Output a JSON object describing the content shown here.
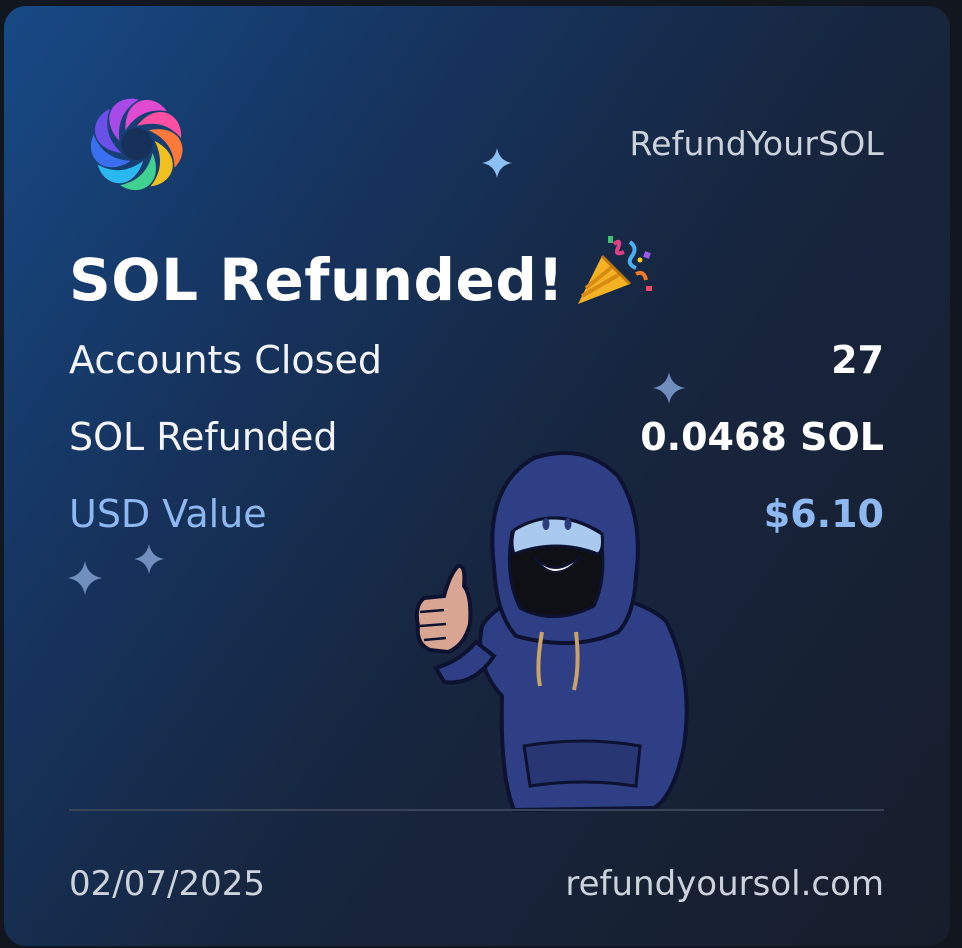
{
  "brand": {
    "name": "RefundYourSOL"
  },
  "title": "SOL Refunded!",
  "stats": [
    {
      "label": "Accounts Closed",
      "value": "27"
    },
    {
      "label": "SOL Refunded",
      "value": "0.0468 SOL"
    },
    {
      "label": "USD Value",
      "value": "$6.10"
    }
  ],
  "footer": {
    "date": "02/07/2025",
    "website": "refundyoursol.com"
  },
  "icons": {
    "logo": "swirl-logo-icon",
    "celebration": "party-popper-icon",
    "decor": "sparkle-icon",
    "mascot": "hooded-mascot-thumbs-up"
  },
  "colors": {
    "accent": "#8eb8f2",
    "sparkle": "#8cb4ec"
  }
}
